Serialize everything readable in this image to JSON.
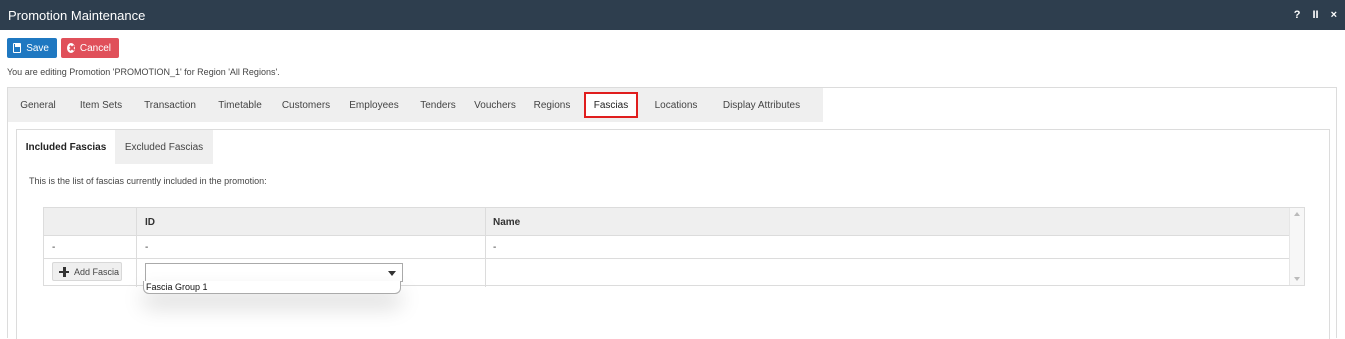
{
  "window": {
    "title": "Promotion Maintenance",
    "controls": [
      "?",
      "II",
      "×"
    ]
  },
  "toolbar": {
    "save_label": "Save",
    "cancel_label": "Cancel"
  },
  "editing_message": "You are editing Promotion 'PROMOTION_1' for Region 'All Regions'.",
  "tabs": [
    {
      "label": "General"
    },
    {
      "label": "Item Sets"
    },
    {
      "label": "Transaction"
    },
    {
      "label": "Timetable"
    },
    {
      "label": "Customers"
    },
    {
      "label": "Employees"
    },
    {
      "label": "Tenders"
    },
    {
      "label": "Vouchers"
    },
    {
      "label": "Regions"
    },
    {
      "label": "Fascias",
      "active": true
    },
    {
      "label": "Locations"
    },
    {
      "label": "Display Attributes"
    }
  ],
  "subtabs": [
    {
      "label": "Included Fascias",
      "active": true
    },
    {
      "label": "Excluded Fascias"
    }
  ],
  "list_description": "This is the list of fascias currently included in the promotion:",
  "grid": {
    "columns": [
      "",
      "ID",
      "Name"
    ],
    "rows": [
      [
        "-",
        "-",
        "-"
      ]
    ],
    "add_button_label": "Add Fascia"
  },
  "select": {
    "value": "",
    "options": [
      "Fascia Group 1"
    ]
  },
  "colors": {
    "titlebar": "#2e3e4e",
    "save": "#1f78c1",
    "cancel": "#e0505a",
    "active_tab_border": "#e01e1e"
  }
}
